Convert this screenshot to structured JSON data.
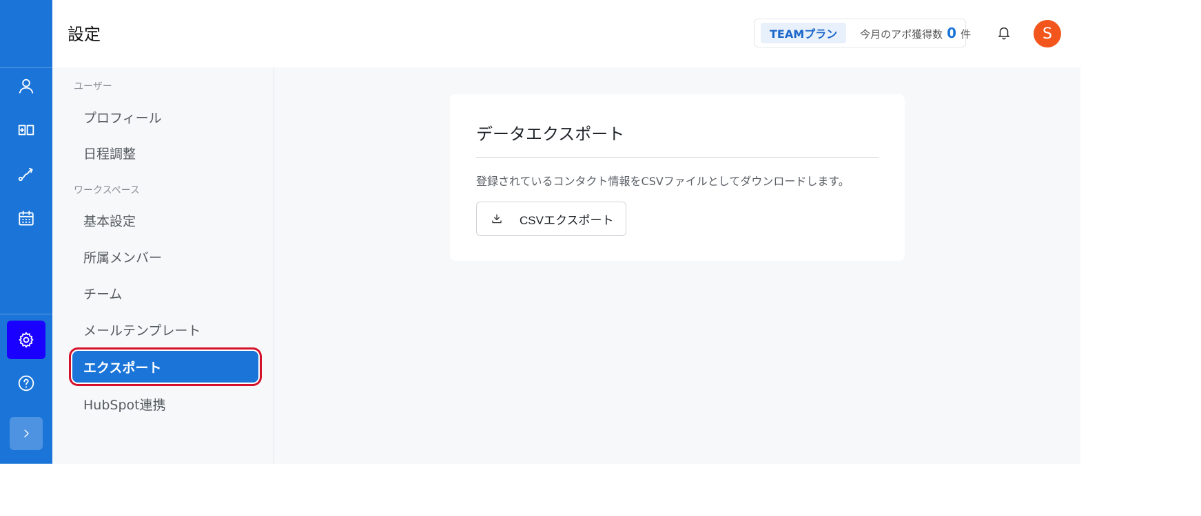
{
  "header": {
    "title": "設定",
    "plan_label": "TEAMプラン",
    "apo_label": "今月のアポ獲得数",
    "apo_count": "0",
    "apo_unit": "件",
    "avatar_initial": "S"
  },
  "rail": {
    "items": [
      {
        "icon": "user-icon"
      },
      {
        "icon": "board-icon"
      },
      {
        "icon": "route-icon"
      },
      {
        "icon": "calendar-icon"
      },
      {
        "icon": "gear-icon",
        "active": true
      },
      {
        "icon": "help-icon"
      },
      {
        "icon": "chevron-right-icon"
      }
    ],
    "active_color": "#1a00ff"
  },
  "settings_nav": {
    "sections": [
      {
        "label": "ユーザー",
        "items": [
          "プロフィール",
          "日程調整"
        ]
      },
      {
        "label": "ワークスペース",
        "items": [
          "基本設定",
          "所属メンバー",
          "チーム",
          "メールテンプレート",
          "エクスポート",
          "HubSpot連携"
        ]
      }
    ],
    "selected": "エクスポート"
  },
  "main": {
    "card": {
      "title": "データエクスポート",
      "description": "登録されているコンタクト情報をCSVファイルとしてダウンロードします。",
      "button_label": "CSVエクスポート"
    }
  },
  "colors": {
    "primary": "#1b75d9",
    "avatar": "#f2561d",
    "highlight_outline": "#d4102a"
  }
}
